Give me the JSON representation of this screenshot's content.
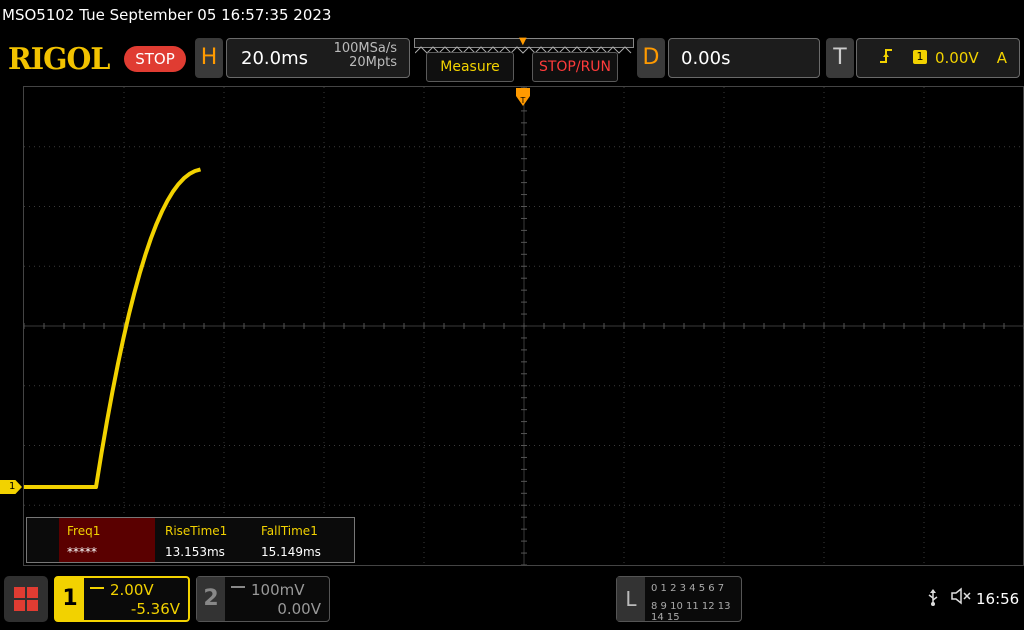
{
  "header": {
    "model_datetime": "MSO5102  Tue September 05 16:57:35 2023",
    "logo": "RIGOL",
    "run_status": "STOP"
  },
  "horizontal": {
    "tab": "H",
    "timebase": "20.0ms",
    "sample_rate": "100MSa/s",
    "memory_depth": "20Mpts"
  },
  "buttons": {
    "measure": "Measure",
    "stop_run": "STOP/RUN"
  },
  "delay": {
    "tab": "D",
    "value": "0.00s"
  },
  "trigger": {
    "tab": "T",
    "source": "1",
    "level": "0.00V",
    "mode": "A"
  },
  "ch1_marker": "1",
  "measurements": {
    "freq": {
      "label": "Freq1",
      "value": "*****"
    },
    "rise": {
      "label": "RiseTime1",
      "value": "13.153ms"
    },
    "fall": {
      "label": "FallTime1",
      "value": "15.149ms"
    }
  },
  "channels": {
    "ch1": {
      "num": "1",
      "scale": "2.00V",
      "offset": "-5.36V",
      "color": "#f2d200"
    },
    "ch2": {
      "num": "2",
      "scale": "100mV",
      "offset": "0.00V",
      "color": "#888888"
    }
  },
  "logic": {
    "tab": "L",
    "row1": "0 1 2 3   4 5 6 7",
    "row2": "8  9 10 11  12 13 14 15"
  },
  "status": {
    "usb_icon": "usb-icon",
    "speaker_icon": "speaker-muted-icon",
    "clock": "16:56"
  },
  "colors": {
    "trace": "#f2d200",
    "accent": "#ff9a00",
    "stop_red": "#e03c32"
  }
}
